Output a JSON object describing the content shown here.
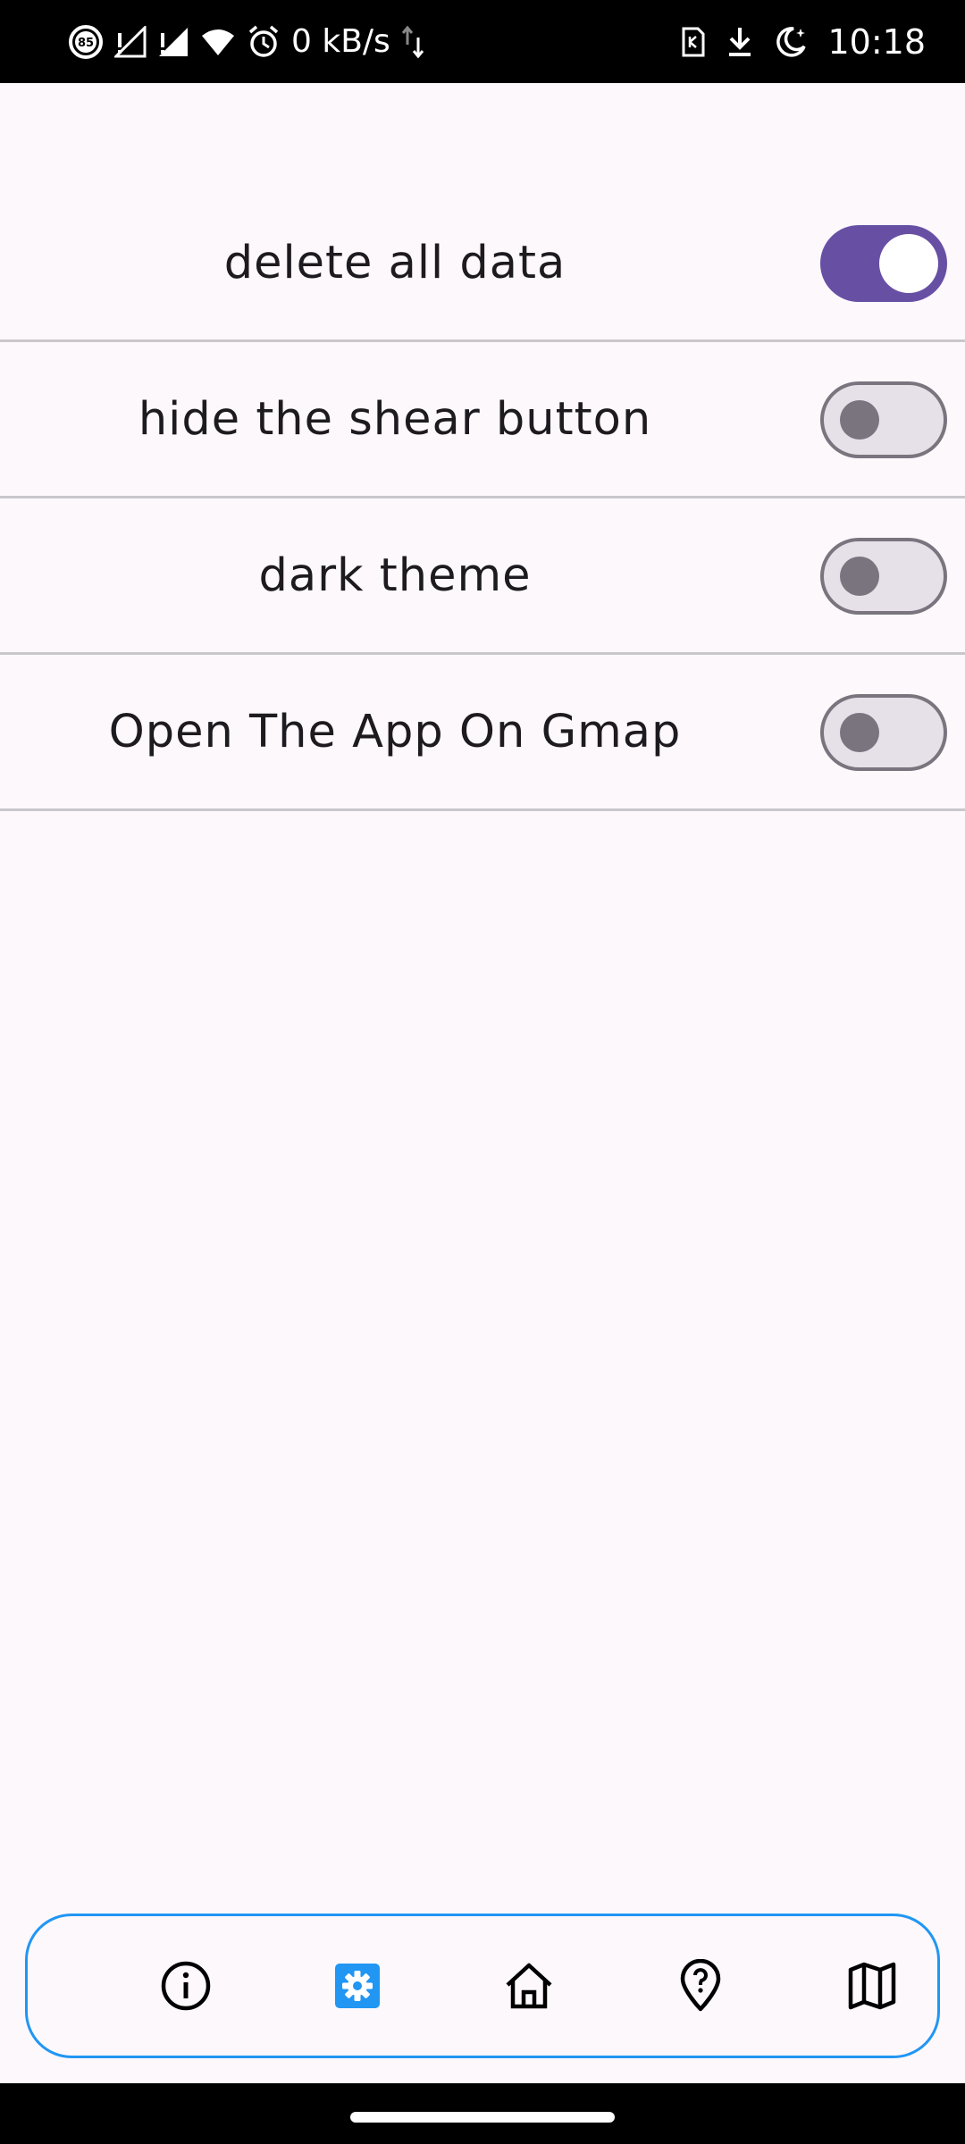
{
  "status_bar": {
    "battery_badge": "85",
    "network_speed": "0 kB/s",
    "time": "10:18",
    "icons": [
      "battery-saver-icon",
      "signal-1-icon",
      "signal-2-icon",
      "wifi-icon",
      "alarm-icon",
      "data-arrows-icon",
      "sim-card-icon",
      "download-icon",
      "do-not-disturb-moon-icon"
    ]
  },
  "settings": [
    {
      "label": "delete all data",
      "enabled": true
    },
    {
      "label": "hide the shear button",
      "enabled": false
    },
    {
      "label": "dark theme",
      "enabled": false
    },
    {
      "label": "Open The App On Gmap",
      "enabled": false
    }
  ],
  "bottom_nav": {
    "items": [
      {
        "icon": "info-icon",
        "active": false
      },
      {
        "icon": "settings-gear-icon",
        "active": true
      },
      {
        "icon": "home-icon",
        "active": false
      },
      {
        "icon": "help-location-pin-icon",
        "active": false
      },
      {
        "icon": "map-icon",
        "active": false
      }
    ],
    "active_color": "#2196f3",
    "border_color": "#2196f3"
  },
  "colors": {
    "switch_on": "#6750a4",
    "switch_off_track": "#e6e0e9",
    "switch_off_outline": "#79747e",
    "background": "#fdf8fc"
  }
}
